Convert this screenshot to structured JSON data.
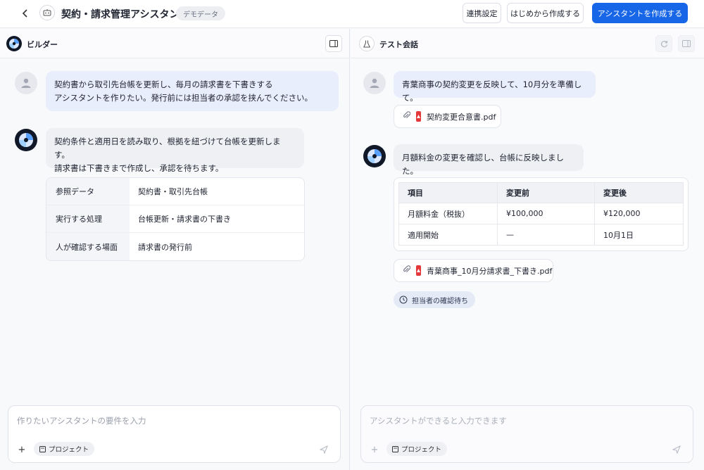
{
  "header": {
    "back_icon": "chevron-left-icon",
    "app_icon": "robot-icon",
    "title": "契約・請求管理アシスタント",
    "demo_badge": "デモデータ",
    "integrations_label": "連携設定",
    "start_over_label": "はじめから作成する",
    "create_label": "アシスタントを作成する",
    "primary_color": "#1766e8"
  },
  "builder": {
    "title": "ビルダー",
    "toggle_icon": "panel-toggle-icon",
    "user_message": [
      "契約書から取引先台帳を更新し、毎月の請求書を下書きする",
      "アシスタントを作りたい。発行前には担当者の承認を挟んでください。"
    ],
    "bot_message": [
      "契約条件と適用日を読み取り、根拠を紐づけて台帳を更新します。",
      "請求書は下書きまで作成し、承認を待ちます。"
    ],
    "summary": [
      {
        "key": "参照データ",
        "value": "契約書・取引先台帳"
      },
      {
        "key": "実行する処理",
        "value": "台帳更新・請求書の下書き"
      },
      {
        "key": "人が確認する場面",
        "value": "請求書の発行前"
      }
    ],
    "composer": {
      "placeholder": "作りたいアシスタントの要件を入力",
      "project_label": "プロジェクト"
    }
  },
  "test": {
    "title": "テスト会話",
    "title_icon": "flask-icon",
    "refresh_icon": "refresh-icon",
    "toggle_icon": "panel-toggle-icon",
    "user_message": "青葉商事の契約変更を反映して、10月分を準備して。",
    "user_attachment": "契約変更合意書.pdf",
    "bot_message": "月額料金の変更を確認し、台帳に反映しました。",
    "change_table": {
      "headers": [
        "項目",
        "変更前",
        "変更後"
      ],
      "rows": [
        [
          "月額料金（税抜）",
          "¥100,000",
          "¥120,000"
        ],
        [
          "適用開始",
          "—",
          "10月1日"
        ]
      ]
    },
    "bot_attachment": "青葉商事_10月分請求書_下書き.pdf",
    "status": "担当者の確認待ち",
    "composer": {
      "placeholder": "アシスタントができると入力できます",
      "project_label": "プロジェクト"
    }
  }
}
